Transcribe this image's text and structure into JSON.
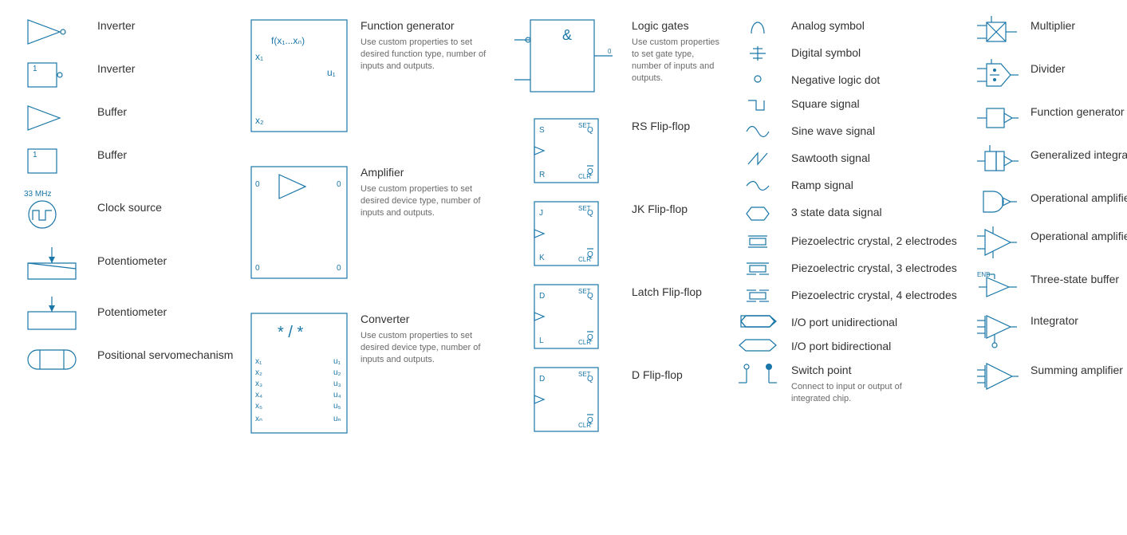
{
  "col1": {
    "inverter1": "Inverter",
    "inverter2": "Inverter",
    "buffer1": "Buffer",
    "buffer2": "Buffer",
    "clock": "Clock source",
    "clock_freq": "33 MHz",
    "pot1": "Potentiometer",
    "pot2": "Potentiometer",
    "servo": "Positional servomechanism",
    "buf_one": "1",
    "inv_one": "1"
  },
  "col2": {
    "fgen_title": "Function generator",
    "fgen_desc": "Use custom properties to set desired function type, number of inputs and outputs.",
    "fgen_expr": "f(x₁...xₙ)",
    "fgen_x1": "x₁",
    "fgen_x2": "x₂",
    "fgen_u1": "u₁",
    "amp_title": "Amplifier",
    "amp_desc": "Use custom properties to set desired device type, number of inputs and outputs.",
    "amp_zero": "0",
    "conv_title": "Converter",
    "conv_desc": "Use custom properties to set desired device type, number of inputs and outputs.",
    "conv_expr": "*/*",
    "conv_x": [
      "x₁",
      "x₂",
      "x₃",
      "x₄",
      "x₅",
      "xₙ"
    ],
    "conv_u": [
      "u₁",
      "u₂",
      "u₃",
      "u₄",
      "u₅",
      "uₙ"
    ]
  },
  "col3": {
    "logic_title": "Logic gates",
    "logic_desc": "Use custom properties to set gate type, number of inputs and outputs.",
    "logic_amp": "&",
    "rs": "RS Flip-flop",
    "jk": "JK Flip-flop",
    "latch": "Latch Flip-flop",
    "d": "D Flip-flop",
    "ff": {
      "S": "S",
      "R": "R",
      "J": "J",
      "K": "K",
      "D": "D",
      "L": "L",
      "Q": "Q",
      "Qb": "Q̄",
      "SET": "SET",
      "CLR": "CLR"
    },
    "logic_zero": "0"
  },
  "col4": {
    "analog": "Analog symbol",
    "digital": "Digital symbol",
    "negdot": "Negative logic dot",
    "square": "Square signal",
    "sine": "Sine wave signal",
    "saw": "Sawtooth signal",
    "ramp": "Ramp signal",
    "threestate": "3 state data signal",
    "piezo2": "Piezoelectric crystal, 2 electrodes",
    "piezo3": "Piezoelectric crystal, 3 electrodes",
    "piezo4": "Piezoelectric crystal, 4 electrodes",
    "iouni": "I/O port unidirectional",
    "iobi": "I/O port bidirectional",
    "switch_title": "Switch point",
    "switch_desc": "Connect to input or output of integrated chip."
  },
  "col5": {
    "mult": "Multiplier",
    "div": "Divider",
    "fgen2": "Function generator",
    "genint": "Generalized integrator",
    "opamp1": "Operational amplifier",
    "opamp2": "Operational amplifier",
    "tsbuf": "Three-state buffer",
    "tsbuf_enb": "ENB",
    "integ": "Integrator",
    "sumamp": "Summing amplifier"
  }
}
